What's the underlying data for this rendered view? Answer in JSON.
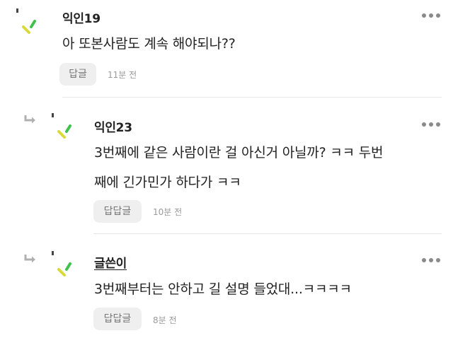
{
  "colors": {
    "accent_green": "#3ec24c",
    "accent_yellow": "#d8d93a",
    "muted": "#9a9a9a",
    "button_bg": "#efefef"
  },
  "comments": [
    {
      "nickname": "익인19",
      "body": "아 또본사람도 계속 해야되나??",
      "reply_label": "답글",
      "time": "11분 전",
      "is_reply": false,
      "icons": [
        "avatar-icon",
        "more-icon"
      ]
    },
    {
      "nickname": "익인23",
      "body_line1": "3번째에 같은 사람이란 걸 아신거 아닐까? ㅋㅋ 두번",
      "body_line2": "째에 긴가민가 하다가 ㅋㅋ",
      "reply_label": "답답글",
      "time": "10분 전",
      "is_reply": true,
      "icons": [
        "reply-arrow-icon",
        "avatar-icon",
        "more-icon"
      ]
    },
    {
      "nickname": "글쓴이",
      "body": "3번째부터는 안하고 길 설명 들었대...ㅋㅋㅋㅋ",
      "reply_label": "답답글",
      "time": "8분 전",
      "is_reply": true,
      "is_author": true,
      "icons": [
        "reply-arrow-icon",
        "avatar-icon",
        "more-icon"
      ]
    }
  ]
}
